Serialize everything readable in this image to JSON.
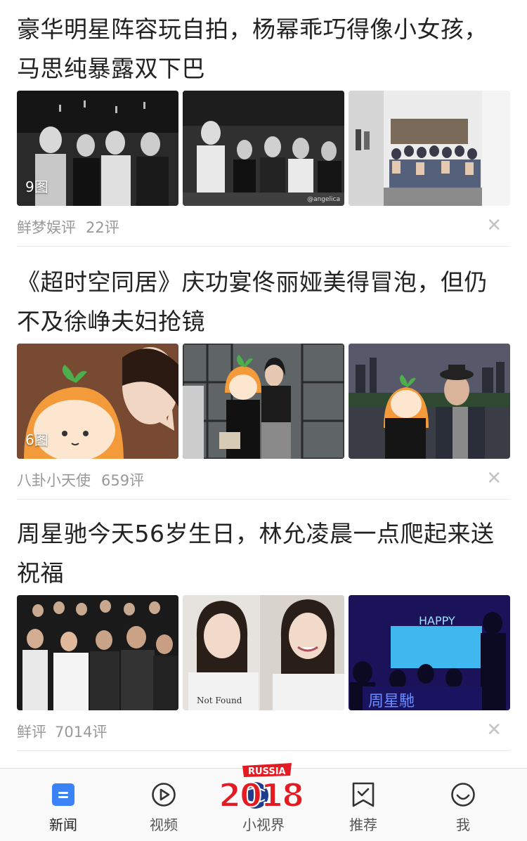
{
  "articles": [
    {
      "title_line1": "豪华明星阵容玩自拍，杨幂乖巧得像小女孩，",
      "title_line2": "马思纯暴露双下巴",
      "image_count": "9图",
      "watermark": "@angelica",
      "source": "鲜梦娱评",
      "comments": "22评"
    },
    {
      "title_line1": "《超时空同居》庆功宴佟丽娅美得冒泡，但仍",
      "title_line2": "不及徐峥夫妇抢镜",
      "image_count": "6图",
      "source": "八卦小天使",
      "comments": "659评"
    },
    {
      "title_line1": "周星驰今天56岁生日，林允凌晨一点爬起来送",
      "title_line2": "祝福",
      "source": "鲜评",
      "comments": "7014评",
      "photo_text_shirt": "Not Found",
      "photo_text_screen": "HAPPY",
      "photo_text_sign": "周星馳"
    }
  ],
  "close_glyph": "✕",
  "tabbar": {
    "tabs": [
      {
        "label": "新闻",
        "icon": "news-icon"
      },
      {
        "label": "视频",
        "icon": "play-icon"
      },
      {
        "label": "小视界",
        "icon": "2018-worldcup-logo"
      },
      {
        "label": "推荐",
        "icon": "bookmark-check-icon"
      },
      {
        "label": "我",
        "icon": "smiley-icon"
      }
    ],
    "logo_small": "RUSSIA",
    "logo_big": "2018"
  },
  "colors": {
    "accent": "#3b82f6",
    "meta_text": "#999999",
    "logo_red": "#e31b23"
  }
}
